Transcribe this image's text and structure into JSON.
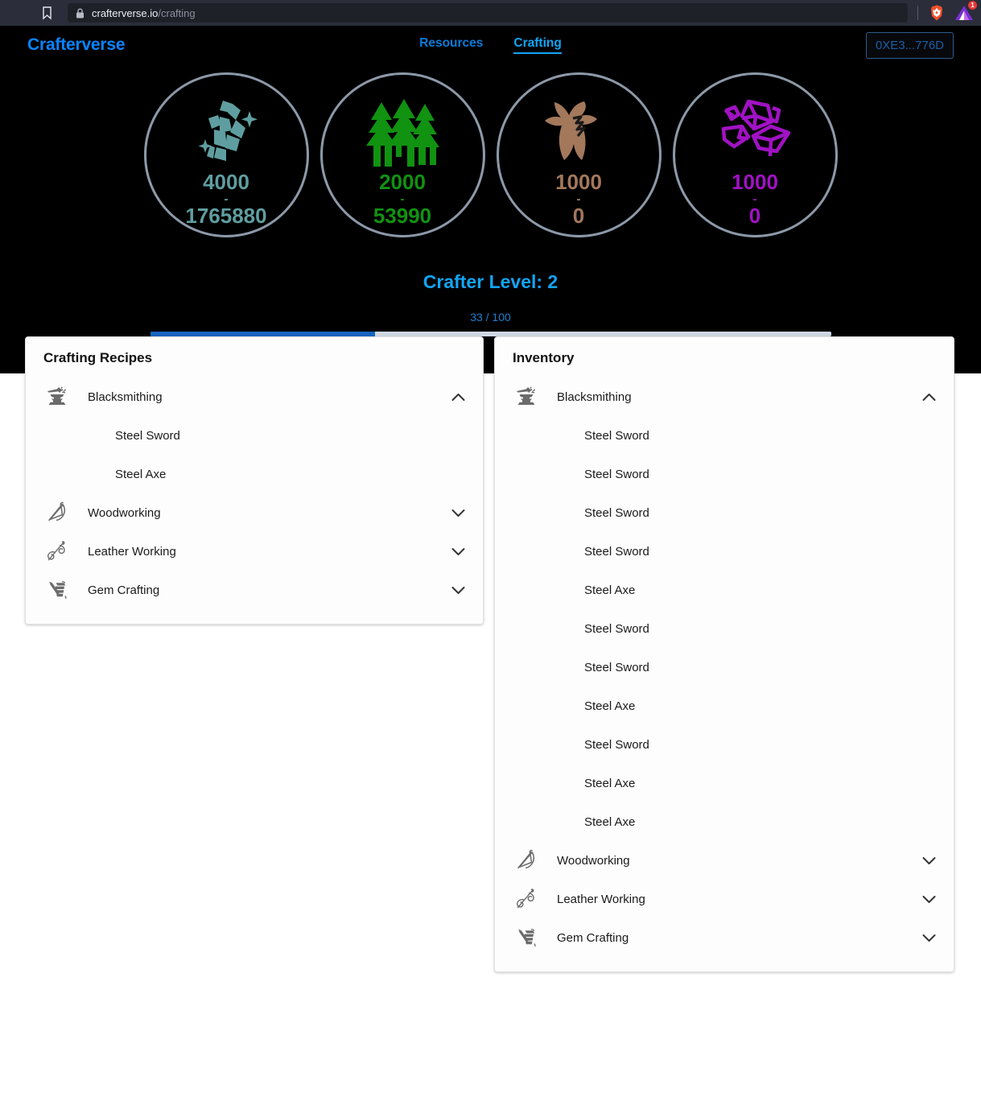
{
  "browser": {
    "url_host": "crafterverse.io",
    "url_path": "/crafting",
    "bookmark_icon": "bookmark-icon",
    "lock_icon": "lock-icon",
    "brave_icon": "brave-shield-icon",
    "extension_icon": "extension-triangle-icon",
    "extension_badge": "1"
  },
  "header": {
    "brand": "Crafterverse",
    "nav": [
      {
        "label": "Resources",
        "active": false
      },
      {
        "label": "Crafting",
        "active": true
      }
    ],
    "wallet": "0XE3...776D"
  },
  "resources": [
    {
      "name": "ore",
      "icon": "ore-icon",
      "color": "#5f9ea0",
      "amount": "4000",
      "dash": "-",
      "total": "1765880"
    },
    {
      "name": "wood",
      "icon": "trees-icon",
      "color": "#119211",
      "amount": "2000",
      "dash": "-",
      "total": "53990"
    },
    {
      "name": "leather",
      "icon": "hide-icon",
      "color": "#a3785b",
      "amount": "1000",
      "dash": "-",
      "total": "0"
    },
    {
      "name": "gems",
      "icon": "gems-icon",
      "color": "#a112c4",
      "amount": "1000",
      "dash": "-",
      "total": "0"
    }
  ],
  "level": {
    "title": "Crafter Level: 2",
    "progress_text": "33 / 100",
    "progress_percent": 33,
    "fill_color": "#1565c0",
    "track_color": "#cfd8e3"
  },
  "recipes_panel": {
    "title": "Crafting Recipes",
    "categories": [
      {
        "label": "Blacksmithing",
        "icon": "anvil-icon",
        "expanded": true,
        "items": [
          "Steel Sword",
          "Steel Axe"
        ]
      },
      {
        "label": "Woodworking",
        "icon": "bow-icon",
        "expanded": false,
        "items": []
      },
      {
        "label": "Leather Working",
        "icon": "needle-thread-icon",
        "expanded": false,
        "items": []
      },
      {
        "label": "Gem Crafting",
        "icon": "gem-chisel-icon",
        "expanded": false,
        "items": []
      }
    ]
  },
  "inventory_panel": {
    "title": "Inventory",
    "categories": [
      {
        "label": "Blacksmithing",
        "icon": "anvil-icon",
        "expanded": true,
        "items": [
          "Steel Sword",
          "Steel Sword",
          "Steel Sword",
          "Steel Sword",
          "Steel Axe",
          "Steel Sword",
          "Steel Sword",
          "Steel Axe",
          "Steel Sword",
          "Steel Axe",
          "Steel Axe"
        ]
      },
      {
        "label": "Woodworking",
        "icon": "bow-icon",
        "expanded": false,
        "items": []
      },
      {
        "label": "Leather Working",
        "icon": "needle-thread-icon",
        "expanded": false,
        "items": []
      },
      {
        "label": "Gem Crafting",
        "icon": "gem-chisel-icon",
        "expanded": false,
        "items": []
      }
    ]
  }
}
